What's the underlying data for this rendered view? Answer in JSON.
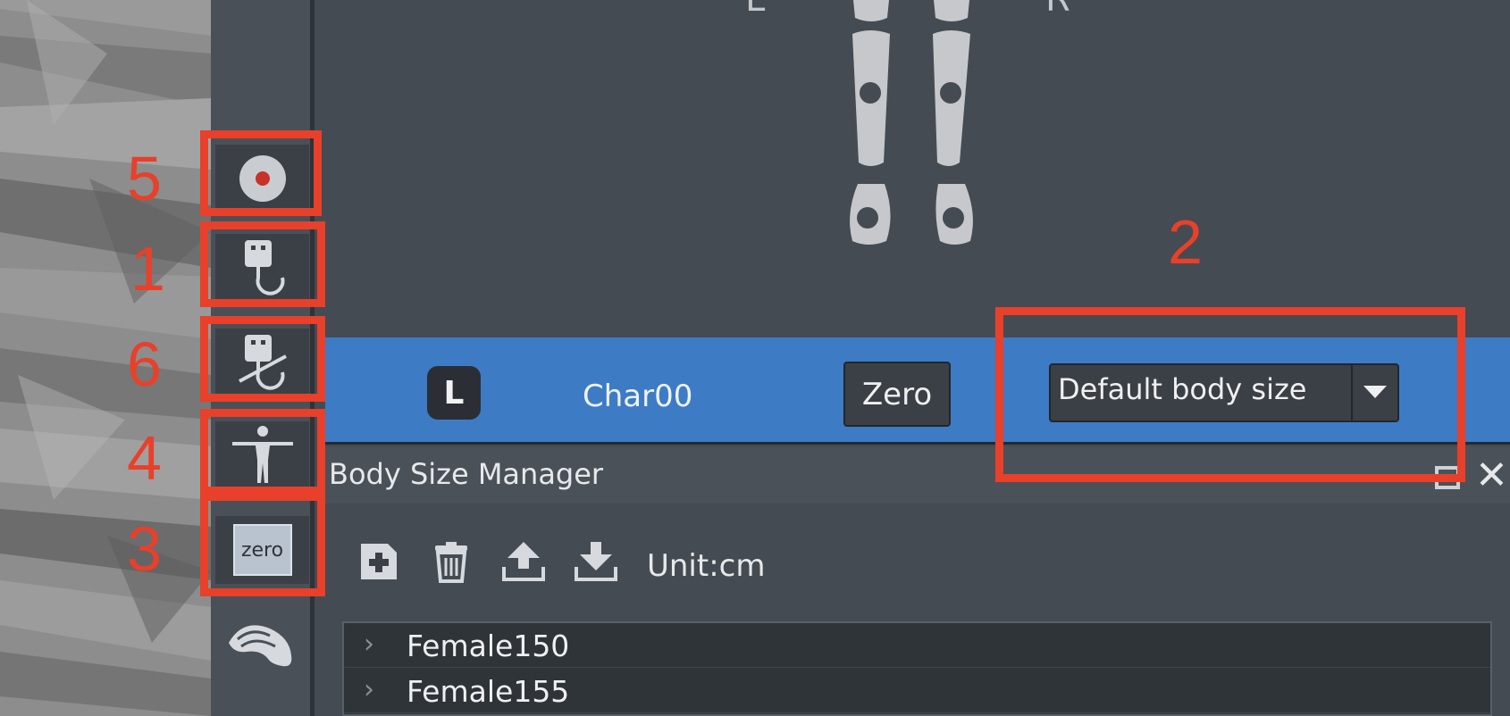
{
  "skeleton": {
    "left_label": "L",
    "right_label": "R"
  },
  "toolbar": {
    "buttons": [
      {
        "name": "record",
        "icon": "record-icon"
      },
      {
        "name": "connect-device",
        "icon": "usb-connect-icon"
      },
      {
        "name": "disconnect-device",
        "icon": "usb-disconnect-icon"
      },
      {
        "name": "t-pose",
        "icon": "t-pose-icon"
      },
      {
        "name": "zero",
        "icon": "zero-icon",
        "label": "zero"
      },
      {
        "name": "mouse",
        "icon": "mouse-icon"
      }
    ]
  },
  "annotations": {
    "n1": "1",
    "n2": "2",
    "n3": "3",
    "n4": "4",
    "n5": "5",
    "n6": "6",
    "color": "#e8402a"
  },
  "character_bar": {
    "lock_badge": "L",
    "character_name": "Char00",
    "zero_button": "Zero",
    "body_size_selected": "Default body size"
  },
  "body_size_manager": {
    "title": "Body Size Manager",
    "unit": "Unit:cm",
    "tools": [
      "add-icon",
      "delete-icon",
      "export-icon",
      "import-icon"
    ],
    "profiles": [
      "Female150",
      "Female155"
    ]
  },
  "colors": {
    "accent_bar": "#3d7bc5",
    "panel_bg": "#454b52",
    "toolbar_bg": "#4a5058"
  }
}
